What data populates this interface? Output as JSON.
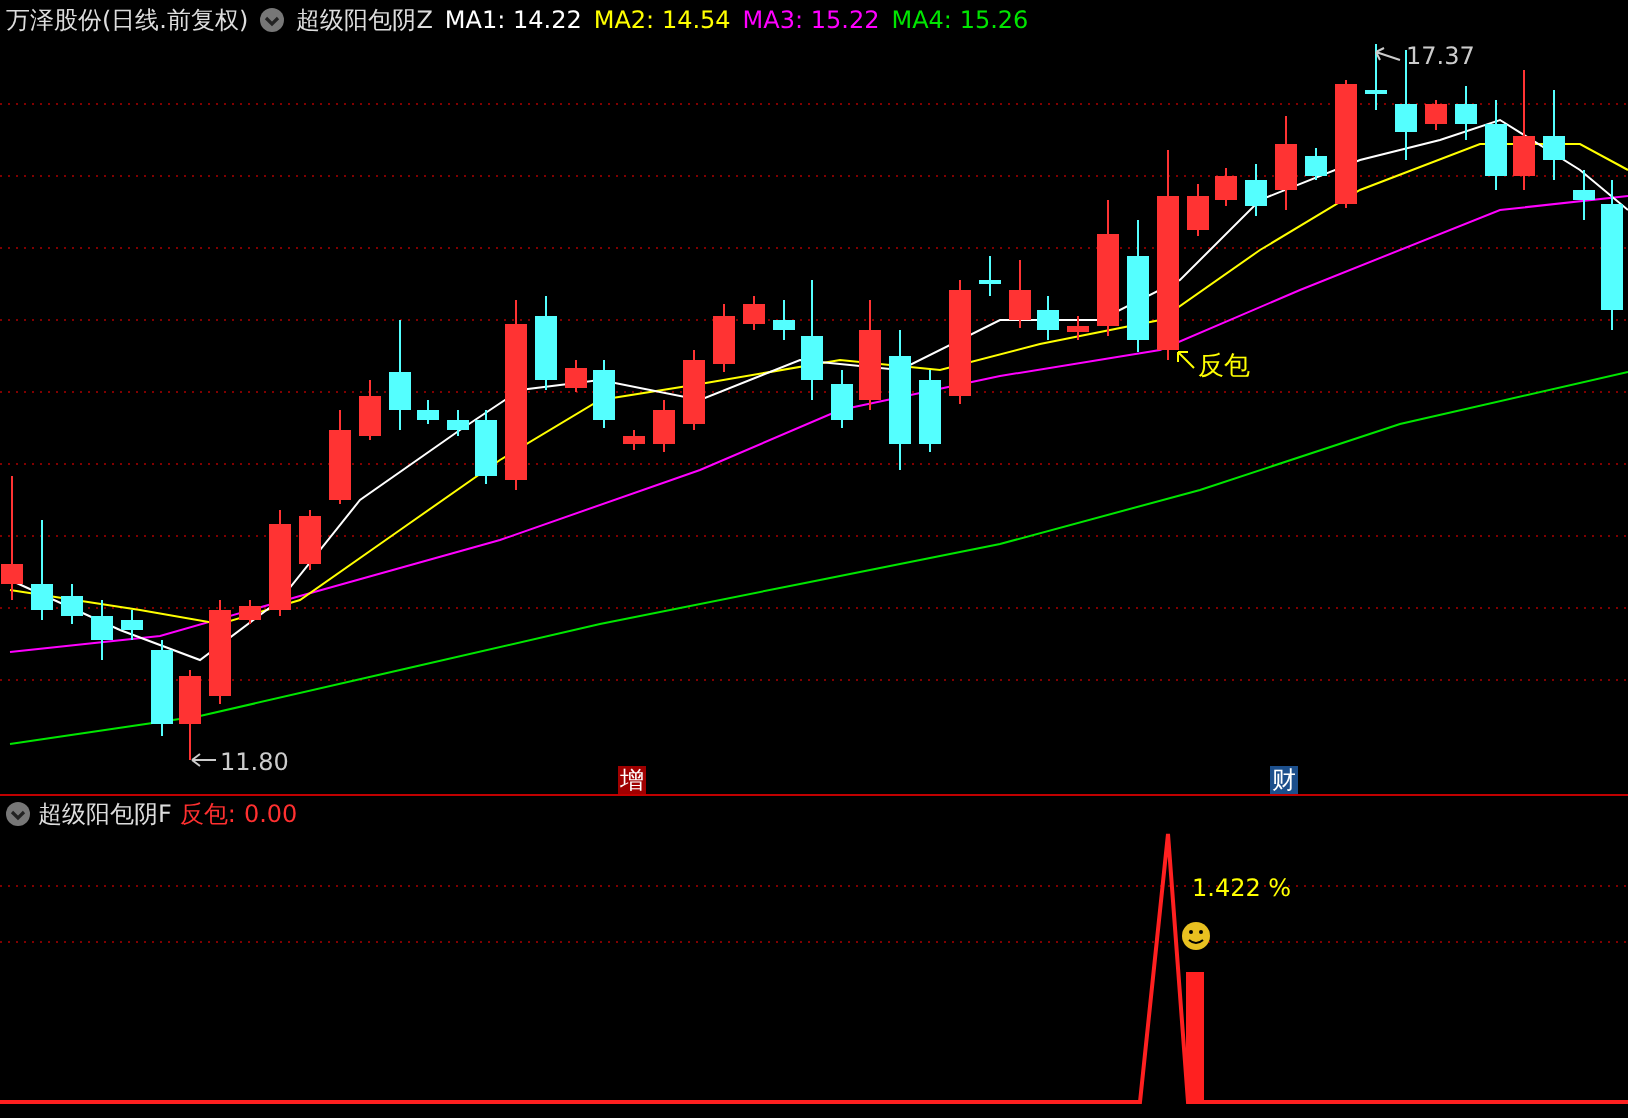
{
  "header": {
    "stock_name": "万泽股份(日线.前复权)",
    "indicator": "超级阳包阴Z",
    "moving_averages": [
      {
        "label": "MA1:",
        "value": "14.22",
        "color": "#ffffff"
      },
      {
        "label": "MA2:",
        "value": "14.54",
        "color": "#ffff00"
      },
      {
        "label": "MA3:",
        "value": "15.22",
        "color": "#ff00ff"
      },
      {
        "label": "MA4:",
        "value": "15.26",
        "color": "#00e600"
      }
    ]
  },
  "main_chart": {
    "high_label": "17.37",
    "low_label": "11.80",
    "signal_label": "反包",
    "event_markers": [
      {
        "text": "增",
        "color": "#a00000"
      },
      {
        "text": "财",
        "color": "#1c4f8c"
      }
    ]
  },
  "sub_panel": {
    "indicator": "超级阳包阴F",
    "series_label": "反包:",
    "series_value": "0.00",
    "annotation": "1.422 %"
  }
}
